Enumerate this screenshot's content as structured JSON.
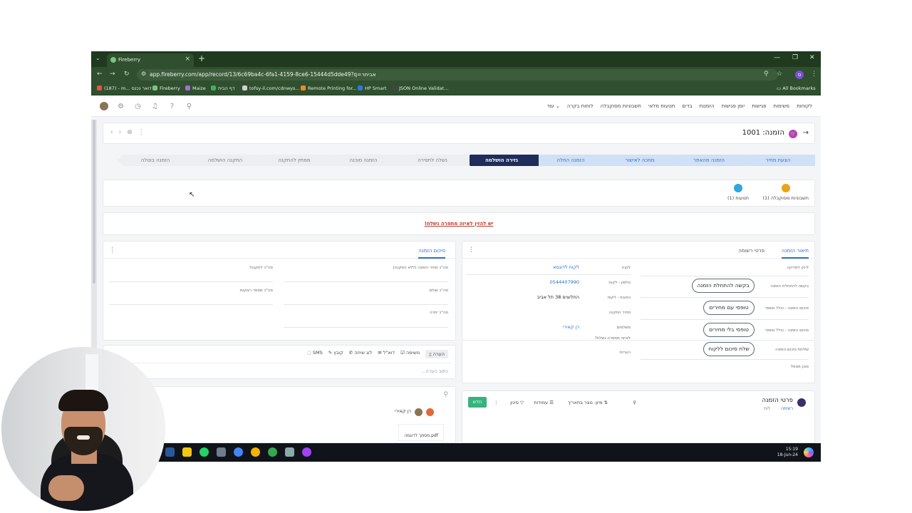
{
  "browser": {
    "tab_title": "Fireberry",
    "tab_close": "×",
    "new_tab": "+",
    "url": "app.fireberry.com/app/record/13/6c69ba4c-6fa1-4159-8ce6-15444d5dde49?q=אביתר",
    "bookmarks": [
      {
        "label": "(187) - m... דואר נכנס",
        "color": "#e8543e"
      },
      {
        "label": "Fireberry",
        "color": "#7bc47b"
      },
      {
        "label": "Maize",
        "color": "#a76bd8"
      },
      {
        "label": "דף הבית",
        "color": "#3bb15e"
      },
      {
        "label": "tofsy-il.com/cdnwys...",
        "color": "#d0d0d0"
      },
      {
        "label": "Remote Printing for...",
        "color": "#f08a24"
      },
      {
        "label": "HP Smart",
        "color": "#2a7bd6"
      },
      {
        "label": "JSON Online Validat...",
        "color": "#444444"
      }
    ],
    "all_bookmarks": "All Bookmarks",
    "profile_initial": "ס"
  },
  "app": {
    "menu": [
      "לקוחות",
      "משימות",
      "פגישות",
      "יומן פגישות",
      "הזמנות",
      "בדים",
      "תנועות מלאי",
      "חשבוניות מסוקבלה",
      "לוחות בקרה",
      "עוד"
    ],
    "record_title": "הזמנה: 1001",
    "stages": [
      {
        "label": "הצעת מחיר",
        "state": "done"
      },
      {
        "label": "הזמנה מהאתר",
        "state": "done"
      },
      {
        "label": "מחכה לאישור",
        "state": "done"
      },
      {
        "label": "הזמנה החלה",
        "state": "done"
      },
      {
        "label": "גזירה הושלמה",
        "state": "cur"
      },
      {
        "label": "נשלה לתפירה",
        "state": "todo"
      },
      {
        "label": "הזמנה מוכנה",
        "state": "todo"
      },
      {
        "label": "ממתין להתקנה",
        "state": "todo"
      },
      {
        "label": "התקנה הושלמה",
        "state": "todo"
      },
      {
        "label": "הזמנה בוטלה",
        "state": "todo"
      }
    ],
    "widgets": [
      {
        "label": "חשבוניות מסוקבלה (1)",
        "color": "#e8a317"
      },
      {
        "label": "תנועות (1)",
        "color": "#2fa6e0"
      }
    ],
    "alert": "יש להזין לאיזה מתפרה נשלח!"
  },
  "order_panel": {
    "tabs": [
      "תיאור הזמנה",
      "פרטי רשומה"
    ],
    "left_labels": [
      "לינק למדיקה",
      "בקשה להתחלת הזמנה",
      "סיכום הזמנה - כולל טופסי",
      "סיכום הזמנה - כולל טופסי",
      "שליחת סיכום הזמנה",
      "סוכן מטפל"
    ],
    "buttons": [
      "בקשה להתחלת הזמנה",
      "טופסי עם מחירים",
      "טופסי בלי מחירים",
      "שלח סיכום ללקוח"
    ],
    "right_labels": [
      "לקוח",
      "טלפון - לקוח",
      "כתובת - לקוח",
      "מחיר התקנה",
      "משלמים",
      "לאיזה מתפרה נשלח?",
      "הערות"
    ],
    "values": {
      "customer": "לקוח לדוגמא",
      "phone": "0544407990",
      "address": "החלוצים 38 תל אביב",
      "payer": "רן קאירי"
    }
  },
  "summary_panel": {
    "tab": "סיכום הזמנה",
    "fields": [
      "סה\"כ מחיר הזמנה (ללא התקנה)",
      "סה\"כ לתקבול",
      "סה\"כ שולם",
      "סה\"כ מספר רצועות",
      "סה\"כ יתרה"
    ]
  },
  "notes": {
    "tabs": [
      "הערה",
      "משימה",
      "דוא\"ל",
      "לוג שיחה",
      "קובץ",
      "SMS"
    ],
    "placeholder": "כתוב הערה..."
  },
  "feed": {
    "user": "רן קאירי",
    "file": "מסמך לדוגמה.pdf"
  },
  "items": {
    "title": "פרטי הזמנה",
    "views": [
      "רשימה",
      "לוח"
    ],
    "tools": [
      "מיון: נוצר בתאריך",
      "עמודות",
      "סינון"
    ],
    "new_btn": "חדש"
  },
  "taskbar": {
    "time": "15:19",
    "date": "18-Jun-24"
  }
}
